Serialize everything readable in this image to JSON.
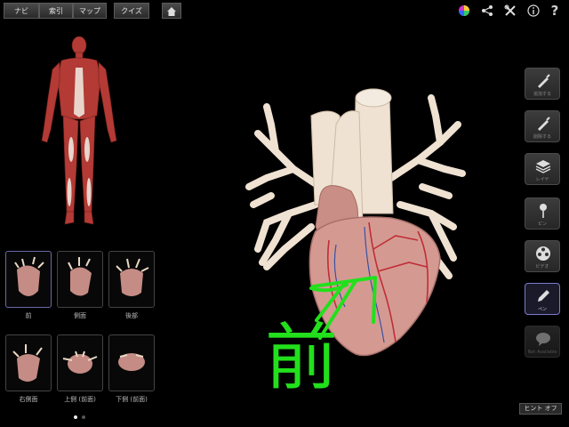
{
  "nav": {
    "navi": "ナビ",
    "index": "索引",
    "map": "マップ",
    "quiz": "クイズ"
  },
  "top_icons": [
    "home-icon",
    "color-wheel-icon",
    "share-icon",
    "tools-icon",
    "info-icon",
    "help-icon"
  ],
  "thumbnails": [
    {
      "label": "前"
    },
    {
      "label": "側面"
    },
    {
      "label": "後部"
    },
    {
      "label": "右側面"
    },
    {
      "label": "上側 (前面)"
    },
    {
      "label": "下側 (前面)"
    }
  ],
  "tools": [
    {
      "label": "追加する",
      "icon": "brush-icon"
    },
    {
      "label": "削除する",
      "icon": "brush-icon"
    },
    {
      "label": "レイヤ",
      "icon": "layers-icon"
    },
    {
      "label": "ピン",
      "icon": "pin-icon"
    },
    {
      "label": "ビデオ",
      "icon": "film-reel-icon"
    },
    {
      "label": "ペン",
      "icon": "pencil-icon"
    },
    {
      "label": "Not Available",
      "icon": "speech-bubble-icon"
    }
  ],
  "hint": "ヒント オフ",
  "annotation_text": "前",
  "colors": {
    "muscle": "#b33a35",
    "heart": "#d49a92",
    "vessel": "#efe2d2",
    "ink": "#22e01c",
    "select": "#7a7ad0"
  }
}
